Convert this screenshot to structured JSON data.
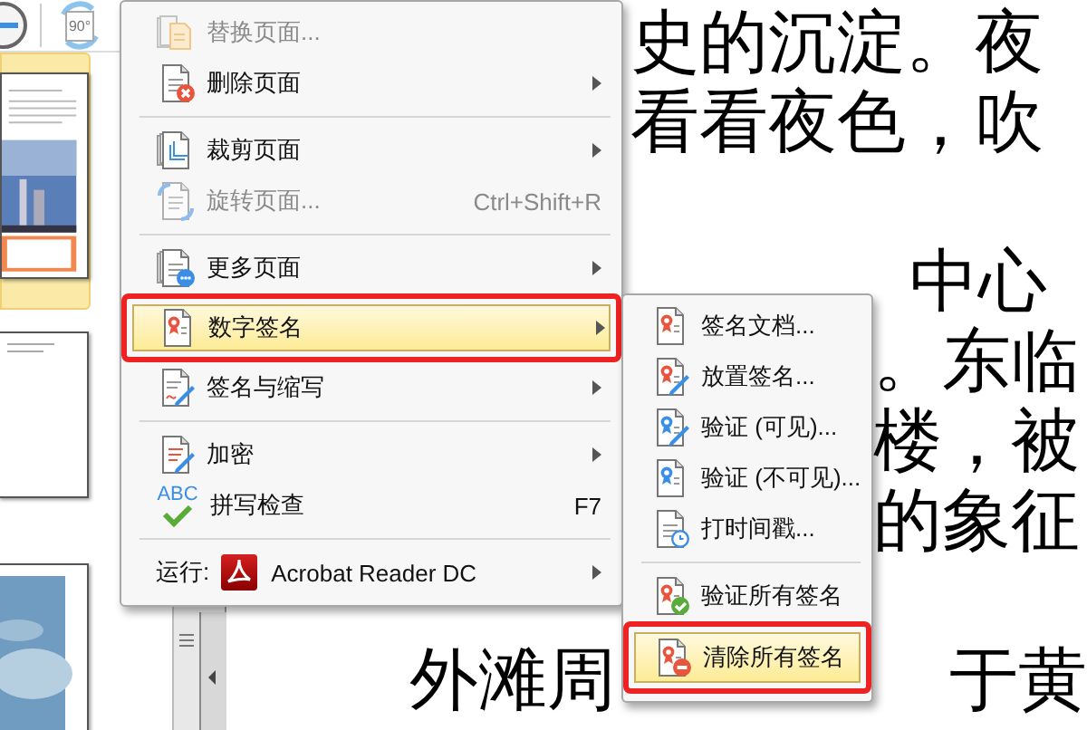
{
  "toolbar": {
    "rotate_label": "90°"
  },
  "thumbnails": [
    {
      "kind": "picture-page",
      "selected": true
    },
    {
      "kind": "text-page",
      "selected": false
    },
    {
      "kind": "photo-page",
      "selected": false
    }
  ],
  "document": {
    "paragraphs": [
      [
        [
          "史的沉淀。夜"
        ],
        [
          "看看夜色，吹"
        ]
      ],
      [
        [
          "中心"
        ],
        [
          "。东临"
        ],
        [
          "楼，被"
        ],
        [
          "的象征"
        ]
      ],
      [
        [
          "外滩周",
          "于黄"
        ]
      ]
    ]
  },
  "main_menu": {
    "items": [
      {
        "kind": "item",
        "label": "替换页面...",
        "disabled": true,
        "submenu": false,
        "selected": false,
        "annotated": false
      },
      {
        "kind": "item",
        "label": "删除页面",
        "disabled": false,
        "submenu": true,
        "selected": false,
        "annotated": false
      },
      {
        "kind": "separator"
      },
      {
        "kind": "item",
        "label": "裁剪页面",
        "disabled": false,
        "submenu": true,
        "selected": false,
        "annotated": false
      },
      {
        "kind": "item",
        "label": "旋转页面...",
        "shortcut": "Ctrl+Shift+R",
        "disabled": true,
        "submenu": false,
        "selected": false,
        "annotated": false
      },
      {
        "kind": "separator"
      },
      {
        "kind": "item",
        "label": "更多页面",
        "disabled": false,
        "submenu": true,
        "selected": false,
        "annotated": false
      },
      {
        "kind": "item",
        "label": "数字签名",
        "disabled": false,
        "submenu": true,
        "selected": true,
        "annotated": true
      },
      {
        "kind": "item",
        "label": "签名与缩写",
        "disabled": false,
        "submenu": true,
        "selected": false,
        "annotated": false
      },
      {
        "kind": "separator"
      },
      {
        "kind": "item",
        "label": "加密",
        "disabled": false,
        "submenu": true,
        "selected": false,
        "annotated": false
      },
      {
        "kind": "item",
        "label": "拼写检查",
        "icon_label": "ABC",
        "shortcut": "F7",
        "disabled": false,
        "submenu": false,
        "selected": false,
        "annotated": false
      },
      {
        "kind": "separator"
      },
      {
        "kind": "run",
        "label": "运行:",
        "app": "Acrobat Reader DC",
        "disabled": false,
        "submenu": true,
        "selected": false,
        "annotated": false
      }
    ]
  },
  "submenu": {
    "items": [
      {
        "kind": "item",
        "label": "签名文档...",
        "selected": false,
        "annotated": false
      },
      {
        "kind": "item",
        "label": "放置签名...",
        "selected": false,
        "annotated": false
      },
      {
        "kind": "item",
        "label": "验证 (可见)...",
        "selected": false,
        "annotated": false
      },
      {
        "kind": "item",
        "label": "验证 (不可见)...",
        "selected": false,
        "annotated": false
      },
      {
        "kind": "item",
        "label": "打时间戳...",
        "selected": false,
        "annotated": false
      },
      {
        "kind": "separator"
      },
      {
        "kind": "item",
        "label": "验证所有签名",
        "selected": false,
        "annotated": false
      },
      {
        "kind": "item",
        "label": "清除所有签名",
        "selected": true,
        "annotated": true
      }
    ]
  }
}
